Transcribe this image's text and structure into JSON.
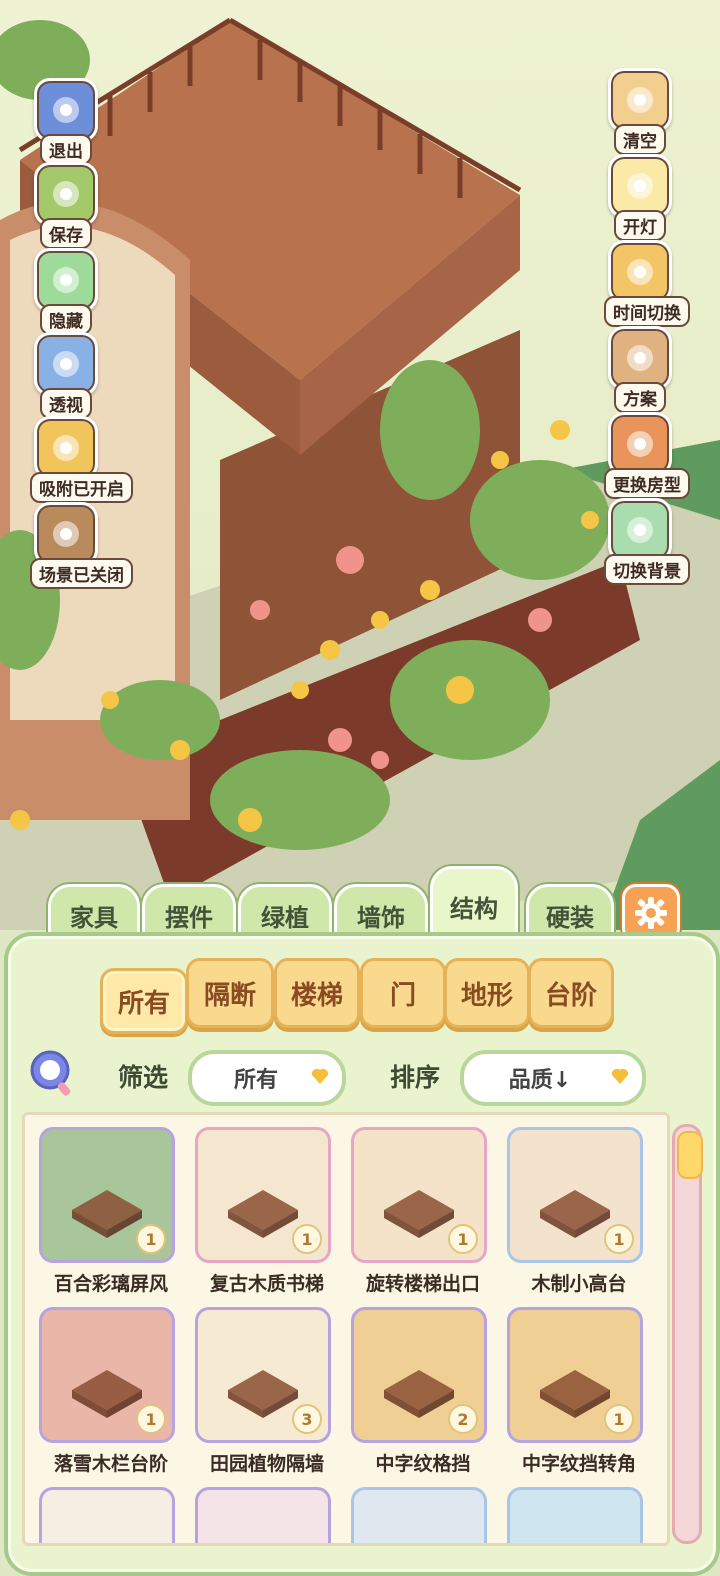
{
  "left_tools": [
    {
      "name": "exit",
      "label": "退出",
      "icon": "exit-arrow-icon",
      "color": "#6d8ed9"
    },
    {
      "name": "save",
      "label": "保存",
      "icon": "save-frog-icon",
      "color": "#a3c96a"
    },
    {
      "name": "hide",
      "label": "隐藏",
      "icon": "hide-clover-icon",
      "color": "#9edb9a"
    },
    {
      "name": "perspective",
      "label": "透视",
      "icon": "perspective-cube-icon",
      "color": "#8ab1e6"
    },
    {
      "name": "snap",
      "label": "吸附已开启",
      "icon": "snap-bear-icon",
      "color": "#f2c45c"
    },
    {
      "name": "scene",
      "label": "场景已关闭",
      "icon": "scene-board-icon",
      "color": "#b98a5c"
    }
  ],
  "right_tools": [
    {
      "name": "clear",
      "label": "清空",
      "icon": "clear-box-icon",
      "color": "#f3cf8f"
    },
    {
      "name": "light",
      "label": "开灯",
      "icon": "light-icon",
      "color": "#fbe9a8"
    },
    {
      "name": "time",
      "label": "时间切换",
      "icon": "time-sun-moon-icon",
      "color": "#f3c567"
    },
    {
      "name": "plan",
      "label": "方案",
      "icon": "plan-folder-icon",
      "color": "#e0b282"
    },
    {
      "name": "house",
      "label": "更换房型",
      "icon": "house-icon",
      "color": "#e9945a"
    },
    {
      "name": "background",
      "label": "切换背景",
      "icon": "background-swap-icon",
      "color": "#a9dcae"
    }
  ],
  "tabs": [
    {
      "label": "家具",
      "active": false
    },
    {
      "label": "摆件",
      "active": false
    },
    {
      "label": "绿植",
      "active": false
    },
    {
      "label": "墙饰",
      "active": false
    },
    {
      "label": "结构",
      "active": true
    },
    {
      "label": "硬装",
      "active": false
    }
  ],
  "settings_icon": "gear-icon",
  "categories": [
    {
      "label": "所有",
      "active": true
    },
    {
      "label": "隔断",
      "active": false
    },
    {
      "label": "楼梯",
      "active": false
    },
    {
      "label": "门",
      "active": false
    },
    {
      "label": "地形",
      "active": false
    },
    {
      "label": "台阶",
      "active": false
    }
  ],
  "filter": {
    "label": "筛选",
    "value": "所有"
  },
  "sort": {
    "label": "排序",
    "value": "品质↓"
  },
  "search_icon": "search-magnifier-icon",
  "items": [
    {
      "name": "百合彩璃屏风",
      "count": "1",
      "border": "#b6a3e0",
      "bg": "#a9c59a"
    },
    {
      "name": "复古木质书梯",
      "count": "1",
      "border": "#e7a6c5",
      "bg": "#f5e6cf"
    },
    {
      "name": "旋转楼梯出口",
      "count": "1",
      "border": "#e7a6c5",
      "bg": "#f4e3c8"
    },
    {
      "name": "木制小高台",
      "count": "1",
      "border": "#a9c6e8",
      "bg": "#f3e3cc"
    },
    {
      "name": "落雪木栏台阶",
      "count": "1",
      "border": "#b6a3e0",
      "bg": "#e9b6a8"
    },
    {
      "name": "田园植物隔墙",
      "count": "3",
      "border": "#b6a3e0",
      "bg": "#f6ead2"
    },
    {
      "name": "中字纹格挡",
      "count": "2",
      "border": "#b6a3e0",
      "bg": "#efcf94"
    },
    {
      "name": "中字纹挡转角",
      "count": "1",
      "border": "#b6a3e0",
      "bg": "#efcf94"
    },
    {
      "name": "",
      "count": "",
      "border": "#b6a3e0",
      "bg": "#f4efe2"
    },
    {
      "name": "",
      "count": "",
      "border": "#b6a3e0",
      "bg": "#f4e4e8"
    },
    {
      "name": "",
      "count": "",
      "border": "#a9c6e8",
      "bg": "#dfe7ef"
    },
    {
      "name": "",
      "count": "",
      "border": "#a9c6e8",
      "bg": "#cfe5f0"
    }
  ]
}
